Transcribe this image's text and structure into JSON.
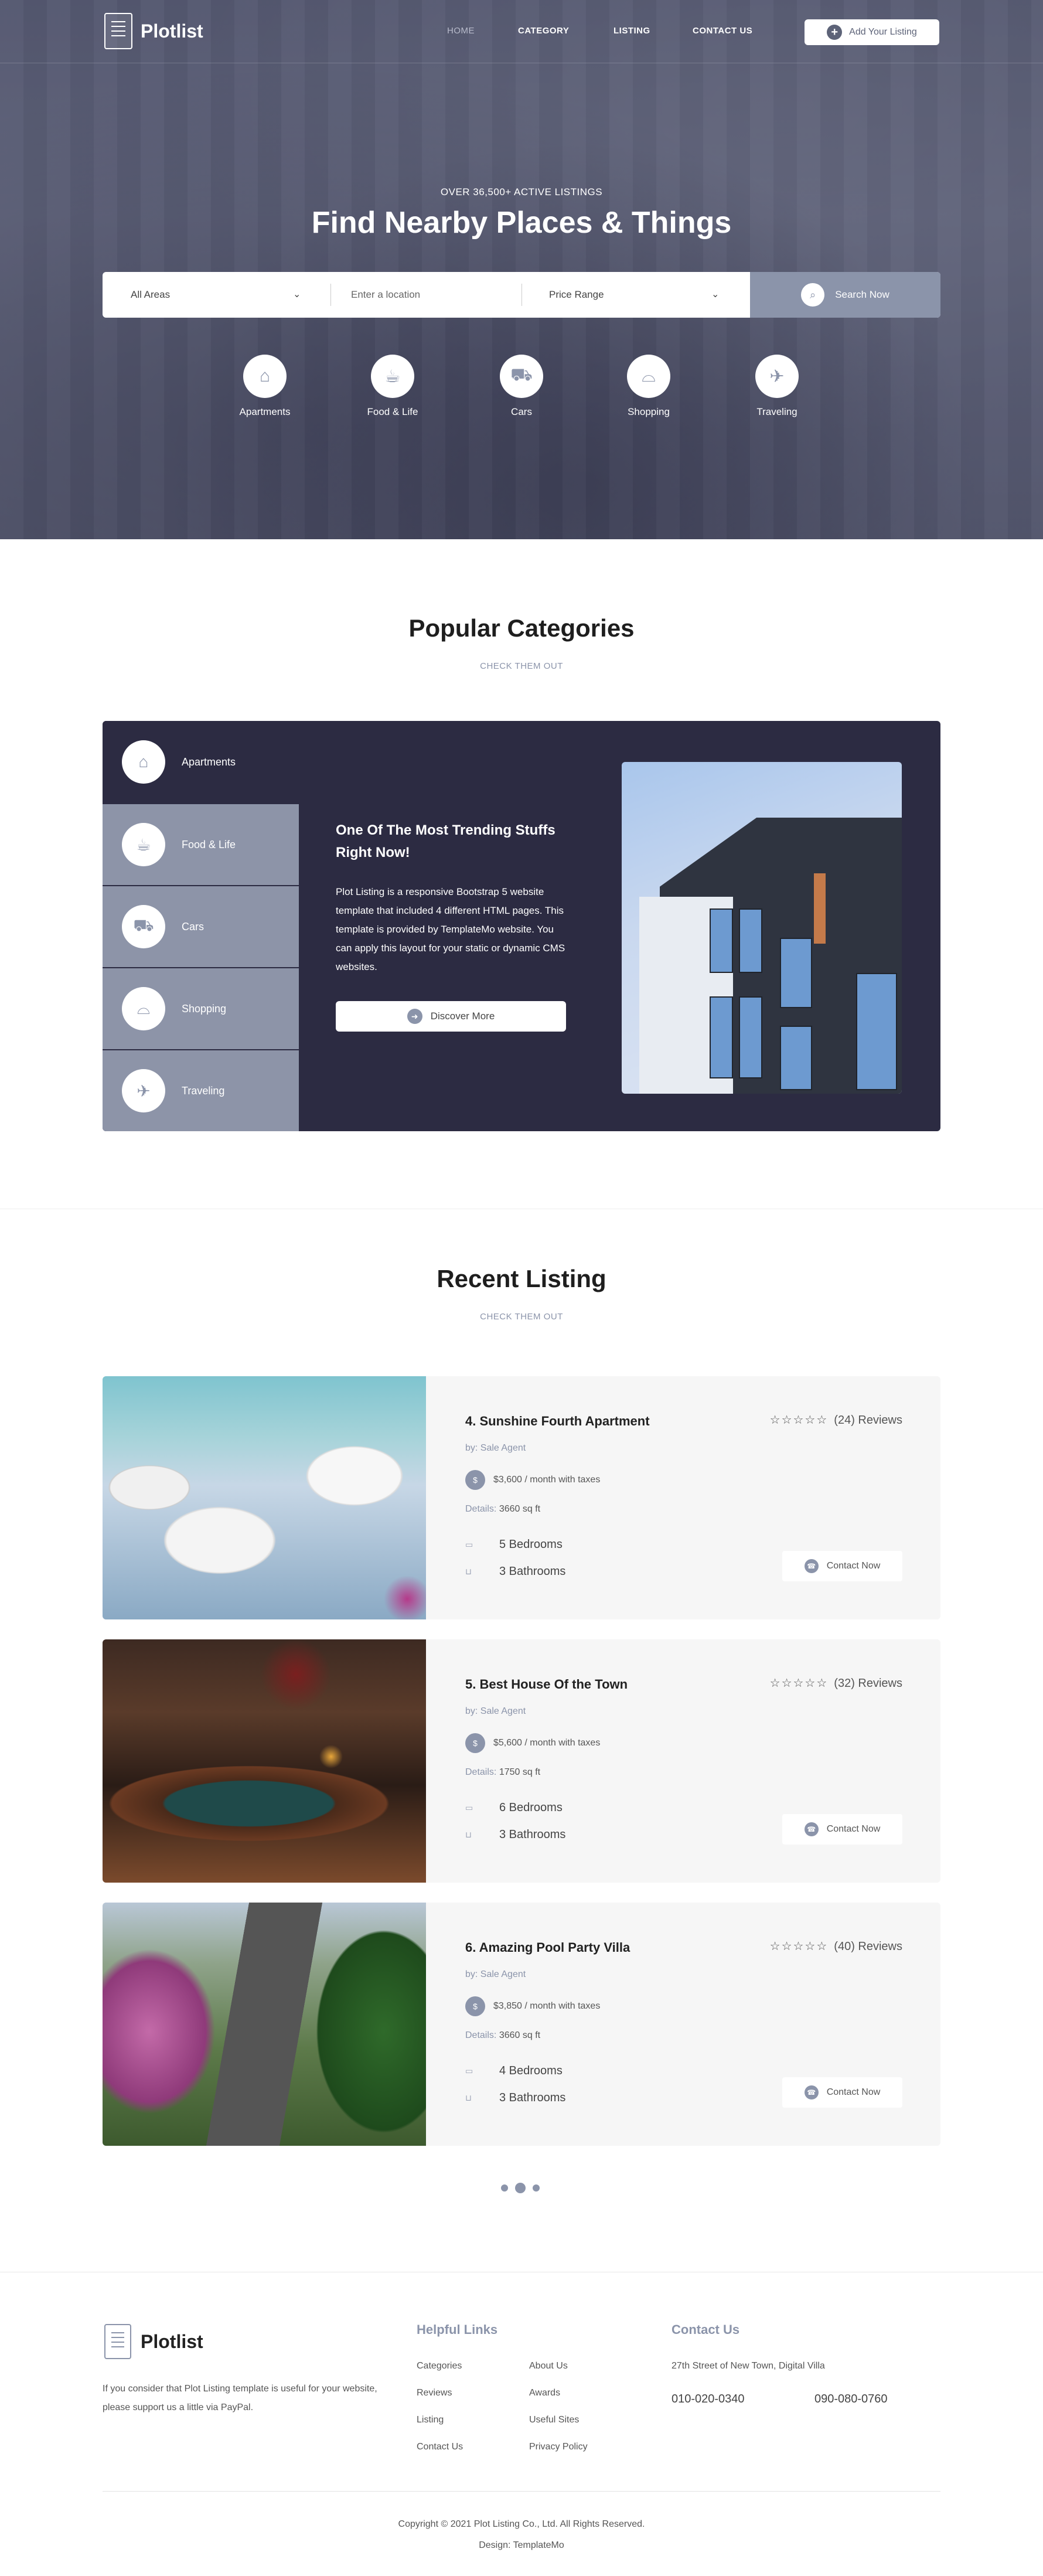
{
  "header": {
    "logo_text": "Plotlist",
    "nav": [
      "HOME",
      "CATEGORY",
      "LISTING",
      "CONTACT US"
    ],
    "add_listing": "Add Your Listing"
  },
  "hero": {
    "subtitle": "OVER 36,500+ ACTIVE LISTINGS",
    "title": "Find Nearby Places & Things",
    "search": {
      "area": "All Areas",
      "location_placeholder": "Enter a location",
      "price": "Price Range",
      "button": "Search Now"
    },
    "categories": [
      {
        "label": "Apartments",
        "icon": "home-icon"
      },
      {
        "label": "Food & Life",
        "icon": "food-icon"
      },
      {
        "label": "Cars",
        "icon": "car-icon"
      },
      {
        "label": "Shopping",
        "icon": "shopping-bag-icon"
      },
      {
        "label": "Traveling",
        "icon": "travel-icon"
      }
    ]
  },
  "popular": {
    "title": "Popular Categories",
    "subtitle": "CHECK THEM OUT",
    "tabs": [
      "Apartments",
      "Food & Life",
      "Cars",
      "Shopping",
      "Traveling"
    ],
    "heading": "One Of The Most Trending Stuffs Right Now!",
    "text": "Plot Listing is a responsive Bootstrap 5 website template that included 4 different HTML pages. This template is provided by TemplateMo website. You can apply this layout for your static or dynamic CMS websites.",
    "button": "Discover More"
  },
  "listing": {
    "title": "Recent Listing",
    "subtitle": "CHECK THEM OUT",
    "items": [
      {
        "title": "4. Sunshine Fourth Apartment",
        "reviews": "(24) Reviews",
        "by": "by: Sale Agent",
        "price": "$3,600 / month with taxes",
        "details_label": "Details:",
        "details": "3660 sq ft",
        "bedrooms": "5 Bedrooms",
        "bathrooms": "3 Bathrooms",
        "contact": "Contact Now"
      },
      {
        "title": "5. Best House Of the Town",
        "reviews": "(32) Reviews",
        "by": "by: Sale Agent",
        "price": "$5,600 / month with taxes",
        "details_label": "Details:",
        "details": "1750 sq ft",
        "bedrooms": "6 Bedrooms",
        "bathrooms": "3 Bathrooms",
        "contact": "Contact Now"
      },
      {
        "title": "6. Amazing Pool Party Villa",
        "reviews": "(40) Reviews",
        "by": "by: Sale Agent",
        "price": "$3,850 / month with taxes",
        "details_label": "Details:",
        "details": "3660 sq ft",
        "bedrooms": "4 Bedrooms",
        "bathrooms": "3 Bathrooms",
        "contact": "Contact Now"
      }
    ]
  },
  "footer": {
    "logo_text": "Plotlist",
    "description": "If you consider that Plot Listing template is useful for your website, please support us a little via PayPal.",
    "links_title": "Helpful Links",
    "links": [
      "Categories",
      "Reviews",
      "Listing",
      "Contact Us",
      "About Us",
      "Awards",
      "Useful Sites",
      "Privacy Policy"
    ],
    "contact_title": "Contact Us",
    "address": "27th Street of New Town, Digital Villa",
    "phone1": "010-020-0340",
    "phone2": "090-080-0760",
    "copyright": "Copyright © 2021 Plot Listing Co., Ltd. All Rights Reserved.",
    "design": "Design: TemplateMo"
  }
}
